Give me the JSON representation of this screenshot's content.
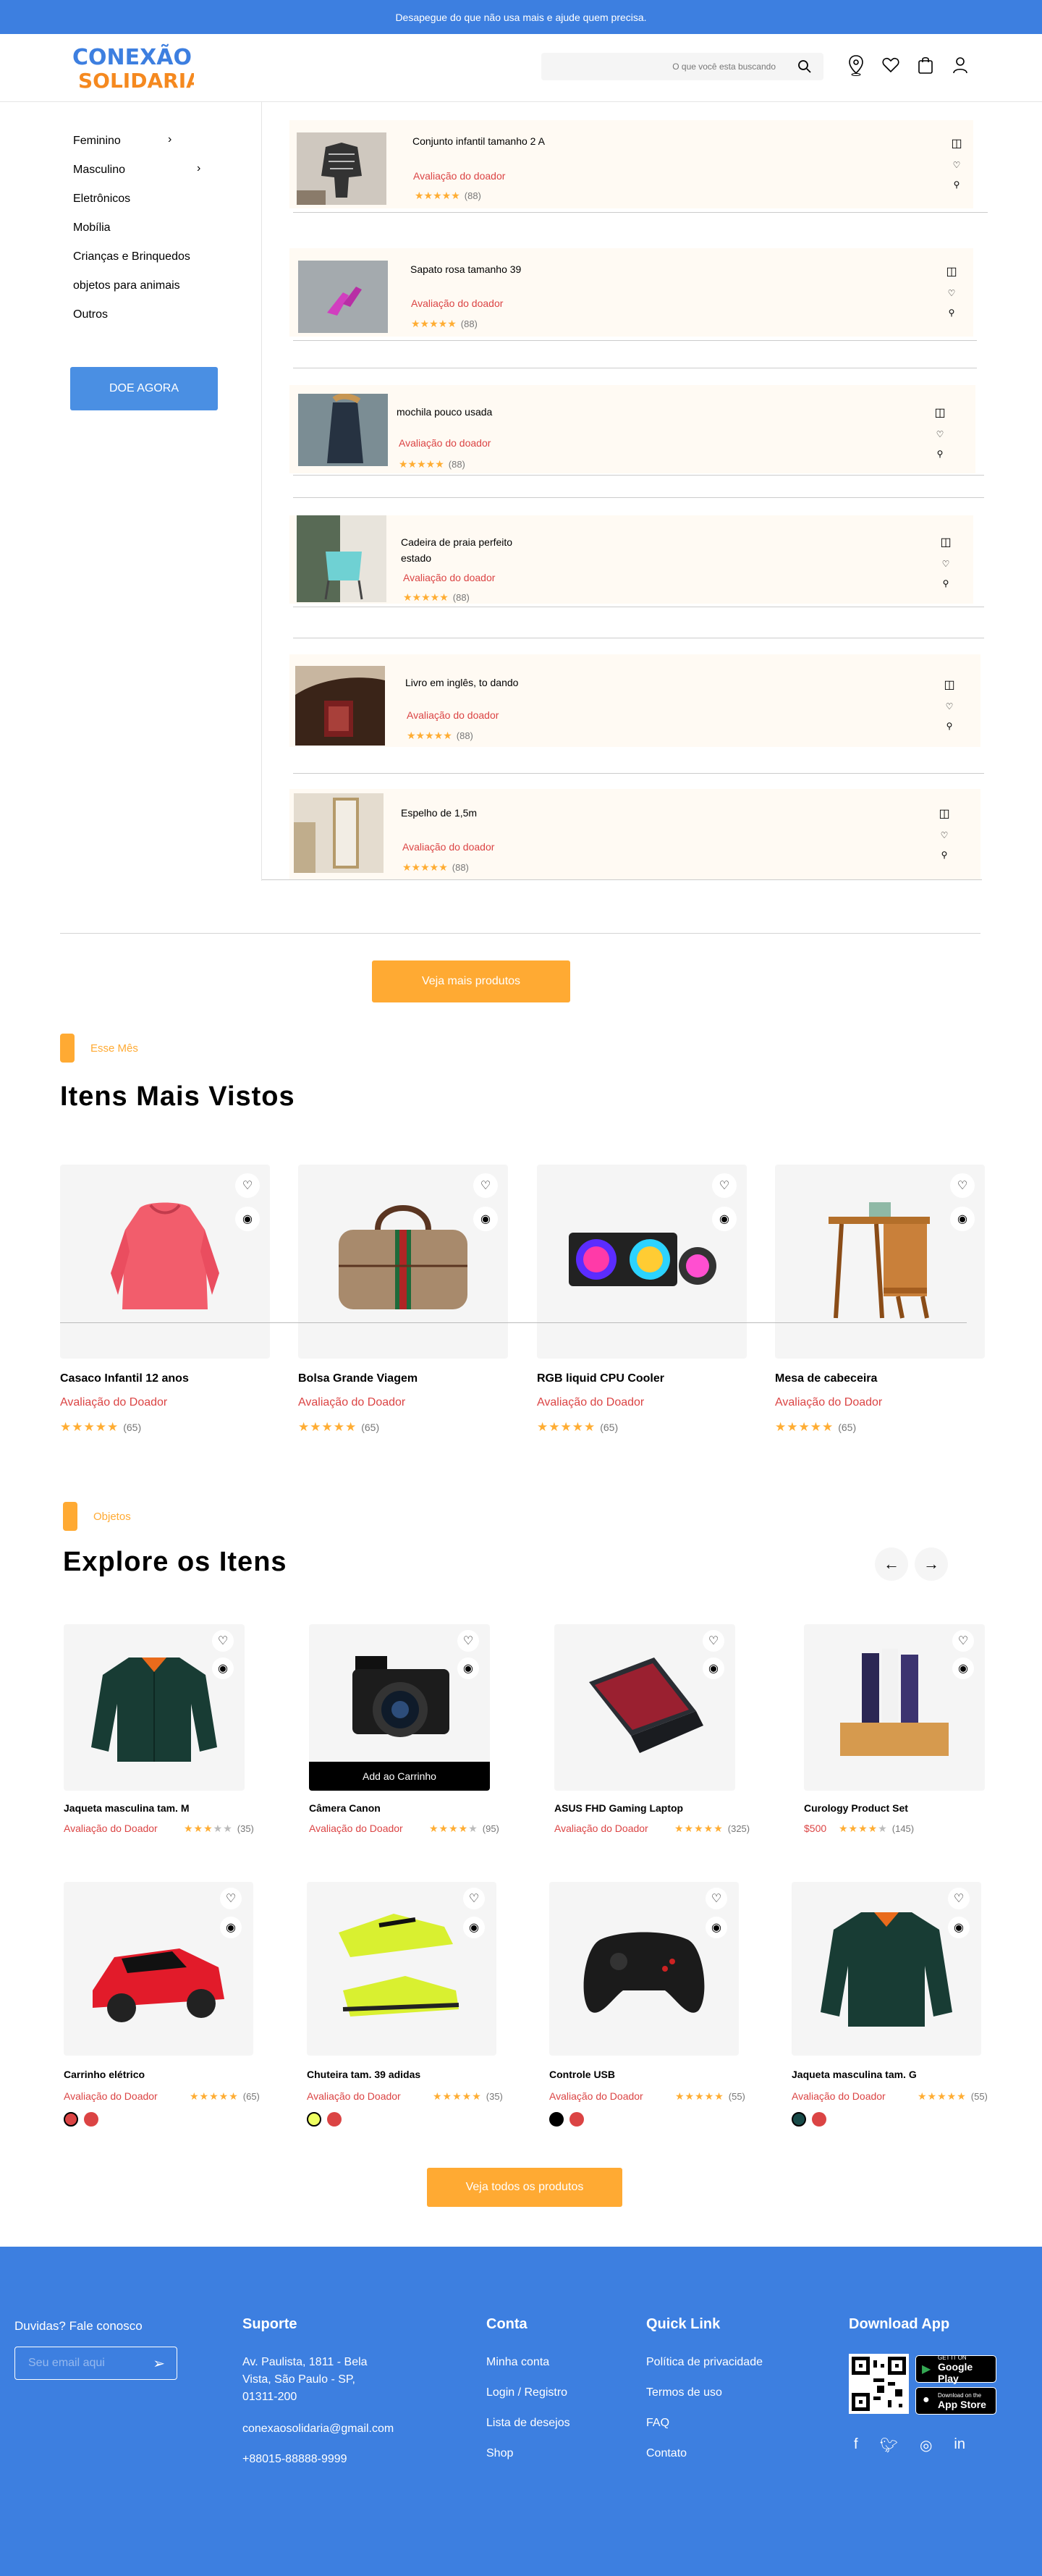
{
  "topbar": {
    "text": "Desapegue do que não usa mais e ajude quem precisa."
  },
  "header": {
    "logo_line1": "CONEXÃO",
    "logo_line2": "SOLIDARIA",
    "search_placeholder": "O que você esta buscando",
    "icons": [
      "location-pin-icon",
      "heart-icon",
      "bag-icon",
      "user-icon"
    ]
  },
  "sidebar": {
    "items": [
      {
        "label": "Feminino",
        "chevron": true
      },
      {
        "label": "Masculino",
        "chevron": true
      },
      {
        "label": "Eletrônicos"
      },
      {
        "label": "Mobília"
      },
      {
        "label": "Crianças e Brinquedos"
      },
      {
        "label": "objetos para animais"
      },
      {
        "label": "Outros"
      }
    ],
    "donate_button": "DOE AGORA"
  },
  "listing": [
    {
      "title": "Conjunto infantil tamanho 2 A",
      "rating_label": "Avaliação  do doador",
      "stars": "★★★★★",
      "count": "(88)"
    },
    {
      "title": "Sapato rosa tamanho 39",
      "rating_label": "Avaliação  do doador",
      "stars": "★★★★★",
      "count": "(88)"
    },
    {
      "title": "mochila pouco usada",
      "rating_label": "Avaliação  do doador",
      "stars": "★★★★★",
      "count": "(88)"
    },
    {
      "title": "Cadeira de praia perfeito estado",
      "rating_label": "Avaliação  do doador",
      "stars": "★★★★★",
      "count": "(88)"
    },
    {
      "title": "Livro em inglês, to dando",
      "rating_label": "Avaliação  do doador",
      "stars": "★★★★★",
      "count": "(88)"
    },
    {
      "title": "Espelho de 1,5m",
      "rating_label": "Avaliação  do doador",
      "stars": "★★★★★",
      "count": "(88)"
    }
  ],
  "more_button": "Veja mais produtos",
  "most_viewed": {
    "tag": "Esse Mês",
    "title": "Itens Mais Vistos",
    "products": [
      {
        "name": "Casaco Infantil 12 anos",
        "rating_label": "Avaliação do Doador",
        "stars": "★★★★★",
        "count": "(65)"
      },
      {
        "name": "Bolsa Grande Viagem",
        "rating_label": "Avaliação do Doador",
        "stars": "★★★★★",
        "count": "(65)"
      },
      {
        "name": "RGB liquid CPU Cooler",
        "rating_label": "Avaliação do Doador",
        "stars": "★★★★★",
        "count": "(65)"
      },
      {
        "name": "Mesa de cabeceira",
        "rating_label": "Avaliação do Doador",
        "stars": "★★★★★",
        "count": "(65)"
      }
    ]
  },
  "explore": {
    "tag": "Objetos",
    "title": "Explore os Itens",
    "add_to_cart": "Add ao Carrinho",
    "row1": [
      {
        "name": "Jaqueta masculina tam. M",
        "rating_label": "Avaliação do Doador",
        "stars": "★★★",
        "stars_off": "★★",
        "count": "(35)"
      },
      {
        "name": "Câmera Canon",
        "rating_label": "Avaliação do Doador",
        "stars": "★★★★",
        "stars_off": "★",
        "count": "(95)"
      },
      {
        "name": "ASUS FHD Gaming Laptop",
        "rating_label": "Avaliação do Doador",
        "stars": "★★★★★",
        "stars_off": "",
        "count": "(325)"
      },
      {
        "name": "Curology Product Set",
        "rating_label": "$500",
        "stars": "★★★★",
        "stars_off": "★",
        "count": "(145)"
      }
    ],
    "row2": [
      {
        "name": "Carrinho elétrico",
        "rating_label": "Avaliação do Doador",
        "stars": "★★★★★",
        "count": "(65)",
        "colors": [
          "#db4444",
          "#db4444"
        ]
      },
      {
        "name": "Chuteira tam. 39 adidas",
        "rating_label": "Avaliação do Doador",
        "stars": "★★★★★",
        "count": "(35)",
        "colors": [
          "#eeff61",
          "#db4444"
        ]
      },
      {
        "name": "Controle USB",
        "rating_label": "Avaliação do Doador",
        "stars": "★★★★★",
        "count": "(55)",
        "colors": [
          "#000000",
          "#db4444"
        ]
      },
      {
        "name": "Jaqueta masculina tam. G",
        "rating_label": "Avaliação do Doador",
        "stars": "★★★★★",
        "count": "(55)",
        "colors": [
          "#184a48",
          "#db4444"
        ]
      }
    ],
    "all_button": "Veja todos os produtos"
  },
  "footer": {
    "newsletter_text": "Duvidas? Fale conosco",
    "email_placeholder": "Seu email aqui",
    "support_title": "Suporte",
    "address": "Av. Paulista, 1811 - Bela Vista, São Paulo - SP, 01311-200",
    "email": "conexaosolidaria@gmail.com",
    "phone": "+88015-88888-9999",
    "account_title": "Conta",
    "account_links": [
      "Minha conta",
      "Login / Registro",
      "Lista de desejos",
      "Shop"
    ],
    "quick_title": "Quick Link",
    "quick_links": [
      "Política de privacidade",
      "Termos de uso",
      "FAQ",
      "Contato"
    ],
    "download_title": "Download App",
    "google_small": "GET IT ON",
    "google_big": "Google Play",
    "apple_small": "Download on the",
    "apple_big": "App Store",
    "social": [
      "facebook-icon",
      "twitter-icon",
      "instagram-icon",
      "linkedin-icon"
    ]
  },
  "colors": {
    "brand_blue": "#3d7fe0",
    "accent_orange": "#ffaa33",
    "rating_red": "#db4444",
    "star": "#ffad33"
  }
}
